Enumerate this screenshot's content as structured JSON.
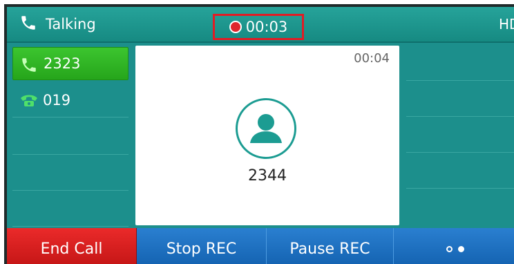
{
  "status": {
    "label": "Talking",
    "icon": "phone-icon"
  },
  "recording": {
    "timer": "00:03",
    "indicator": "record-dot"
  },
  "hd_badge": "HD",
  "lines": [
    {
      "label": "2323",
      "icon": "phone-icon",
      "active": true
    },
    {
      "label": "019",
      "icon": "telephone-icon",
      "active": false
    }
  ],
  "call_card": {
    "duration": "00:04",
    "contact": "2344",
    "avatar_icon": "contact-avatar-icon"
  },
  "softkeys": {
    "end_call": "End Call",
    "stop_rec": "Stop REC",
    "pause_rec": "Pause REC",
    "more_icon": "page-dots-icon"
  },
  "colors": {
    "accent": "#1c8f8c",
    "active_line": "#30b823",
    "end_call": "#d61c1c",
    "softkey": "#1a6fc2",
    "rec_frame": "#e11c24"
  }
}
